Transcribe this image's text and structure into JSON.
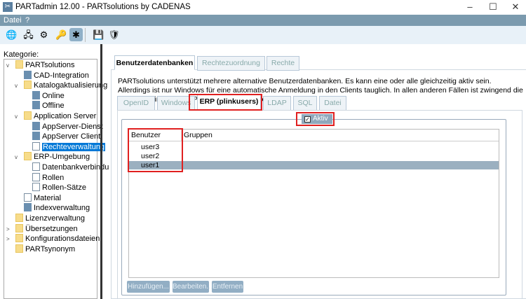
{
  "window": {
    "title": "PARTadmin 12.00 - PARTsolutions by CADENAS",
    "minimize": "–",
    "maximize": "☐",
    "close": "✕"
  },
  "menu": [
    "Datei",
    "?"
  ],
  "toolbar": [
    {
      "icon": "globe-sync-icon",
      "glyph": "🌐"
    },
    {
      "icon": "server-icon",
      "glyph": "🖧"
    },
    {
      "icon": "hierarchy-icon",
      "glyph": "⚙"
    },
    {
      "icon": "keys-icon",
      "glyph": "🔑"
    },
    {
      "icon": "rights-gear-icon",
      "glyph": "✱"
    },
    {
      "icon": "save-icon",
      "glyph": "💾"
    },
    {
      "icon": "shield-icon",
      "glyph": "🛡"
    }
  ],
  "sidebar": {
    "label": "Kategorie:",
    "items": [
      {
        "label": "PARTsolutions",
        "level": 0,
        "icon": "folder",
        "exp": "v"
      },
      {
        "label": "CAD-Integration",
        "level": 1,
        "icon": "gear"
      },
      {
        "label": "Katalogaktualisierung",
        "level": 1,
        "icon": "folder",
        "exp": "v"
      },
      {
        "label": "Online",
        "level": 2,
        "icon": "gear"
      },
      {
        "label": "Offline",
        "level": 2,
        "icon": "gear"
      },
      {
        "label": "Application Server",
        "level": 1,
        "icon": "folder",
        "exp": "v"
      },
      {
        "label": "AppServer-Dienst",
        "level": 2,
        "icon": "gear"
      },
      {
        "label": "AppServer Client",
        "level": 2,
        "icon": "gear"
      },
      {
        "label": "Rechteverwaltung",
        "level": 2,
        "icon": "page",
        "selected": true
      },
      {
        "label": "ERP-Umgebung",
        "level": 1,
        "icon": "folder",
        "exp": "v"
      },
      {
        "label": "Datenbankverbindu",
        "level": 2,
        "icon": "page"
      },
      {
        "label": "Rollen",
        "level": 2,
        "icon": "page"
      },
      {
        "label": "Rollen-Sätze",
        "level": 2,
        "icon": "page"
      },
      {
        "label": "Material",
        "level": 1,
        "icon": "page"
      },
      {
        "label": "Indexverwaltung",
        "level": 1,
        "icon": "gear"
      },
      {
        "label": "Lizenzverwaltung",
        "level": 0,
        "icon": "folder"
      },
      {
        "label": "Übersetzungen",
        "level": 0,
        "icon": "folder",
        "exp": ">"
      },
      {
        "label": "Konfigurationsdateien",
        "level": 0,
        "icon": "folder",
        "exp": ">"
      },
      {
        "label": "PARTsynonym",
        "level": 0,
        "icon": "folder"
      }
    ]
  },
  "main": {
    "tabs": [
      "Benutzerdatenbanken",
      "Rechtezuordnung",
      "Rechte"
    ],
    "description": "PARTsolutions unterstützt mehrere alternative Benutzerdatenbanken. Es kann eine oder alle gleichzeitig aktiv sein. Allerdings ist nur Windows für eine automatische Anmeldung in den Clients tauglich. In allen anderen Fällen ist zwingend die manuelle Eingabe des Passwortes erforderlich.",
    "subtabs": [
      "OpenID",
      "Windows",
      "ERP (plinkusers)",
      "LDAP",
      "SQL",
      "Datei"
    ],
    "active_checkbox": {
      "label": "Aktiv",
      "checked": true,
      "mark": "✓"
    },
    "table": {
      "columns": [
        "Benutzer",
        "Gruppen"
      ],
      "rows": [
        [
          "user3",
          ""
        ],
        [
          "user2",
          ""
        ],
        [
          "user1",
          ""
        ]
      ],
      "selected_row": 2
    },
    "buttons": [
      "Hinzufügen...",
      "Bearbeiten...",
      "Entfernen"
    ]
  },
  "colors": {
    "highlight": "#e02020",
    "selection": "#0078d7",
    "menubar": "#7b9aae"
  }
}
